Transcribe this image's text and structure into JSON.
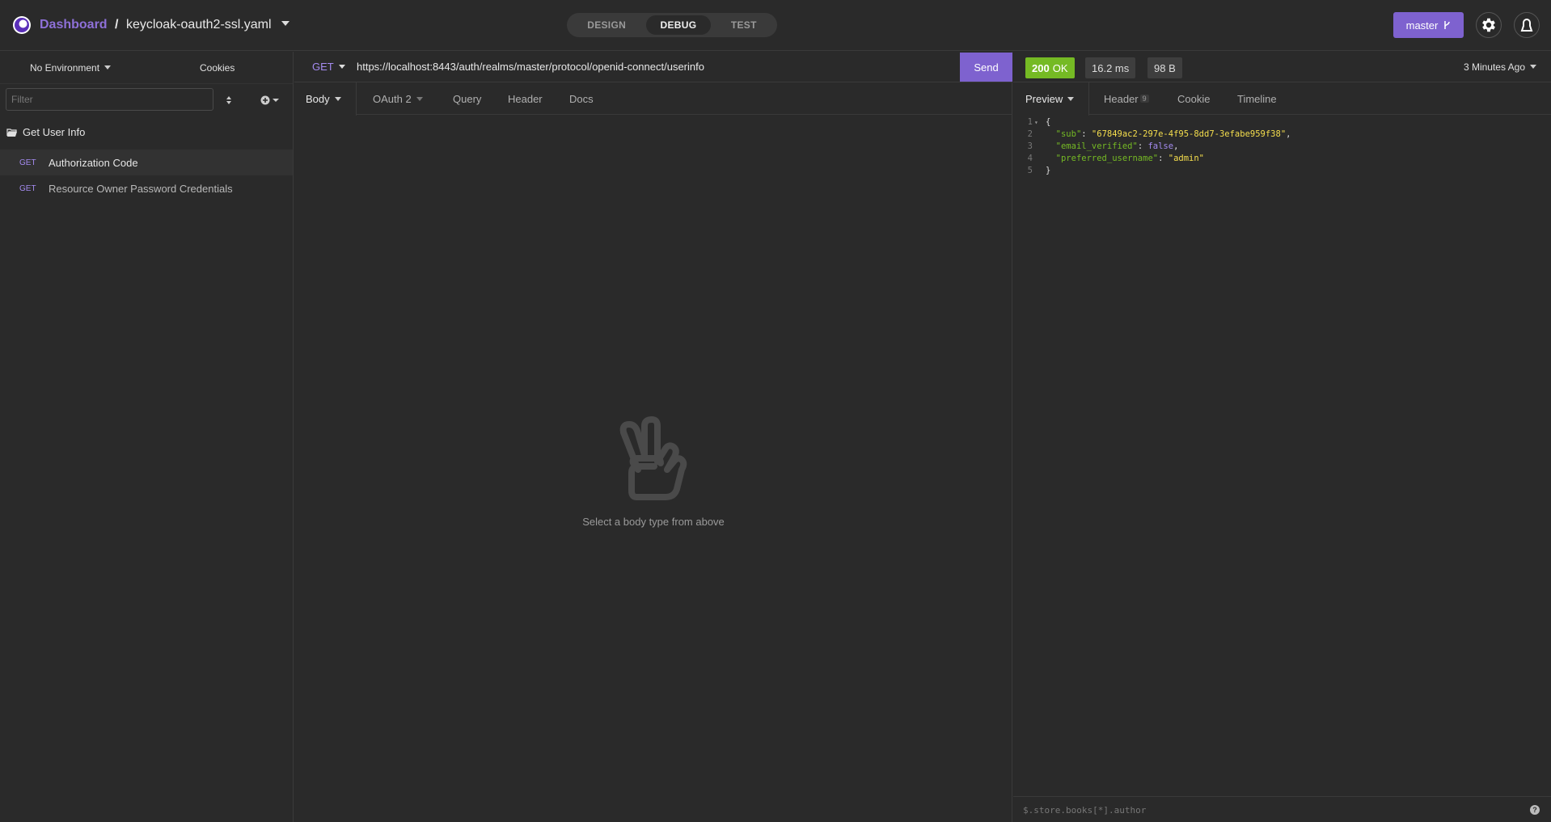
{
  "header": {
    "dashboard": "Dashboard",
    "separator": "/",
    "file": "keycloak-oauth2-ssl.yaml",
    "modes": [
      "DESIGN",
      "DEBUG",
      "TEST"
    ],
    "active_mode": "DEBUG",
    "branch": "master"
  },
  "sidebar": {
    "environment": "No Environment",
    "cookies": "Cookies",
    "filter_placeholder": "Filter",
    "folder": "Get User Info",
    "requests": [
      {
        "method": "GET",
        "name": "Authorization Code",
        "active": true
      },
      {
        "method": "GET",
        "name": "Resource Owner Password Credentials",
        "active": false
      }
    ]
  },
  "request": {
    "method": "GET",
    "url": "https://localhost:8443/auth/realms/master/protocol/openid-connect/userinfo",
    "send": "Send",
    "tabs": [
      "Body",
      "OAuth 2",
      "Query",
      "Header",
      "Docs"
    ],
    "empty_text": "Select a body type from above"
  },
  "response": {
    "status_code": "200",
    "status_text": "OK",
    "time": "16.2 ms",
    "size": "98 B",
    "ago": "3 Minutes Ago",
    "tabs": [
      "Preview",
      "Header",
      "Cookie",
      "Timeline"
    ],
    "header_count": "9",
    "lines": [
      "1",
      "2",
      "3",
      "4",
      "5"
    ],
    "body": {
      "open": "{",
      "sub_key": "\"sub\"",
      "sub_val": "\"67849ac2-297e-4f95-8dd7-3efabe959f38\"",
      "email_key": "\"email_verified\"",
      "email_val": "false",
      "user_key": "\"preferred_username\"",
      "user_val": "\"admin\"",
      "close": "}"
    },
    "filter_placeholder": "$.store.books[*].author",
    "help": "?"
  },
  "colors": {
    "accent": "#7e62cf",
    "ok": "#75ba24",
    "string": "#f6df4d",
    "bool": "#a48bf0"
  }
}
